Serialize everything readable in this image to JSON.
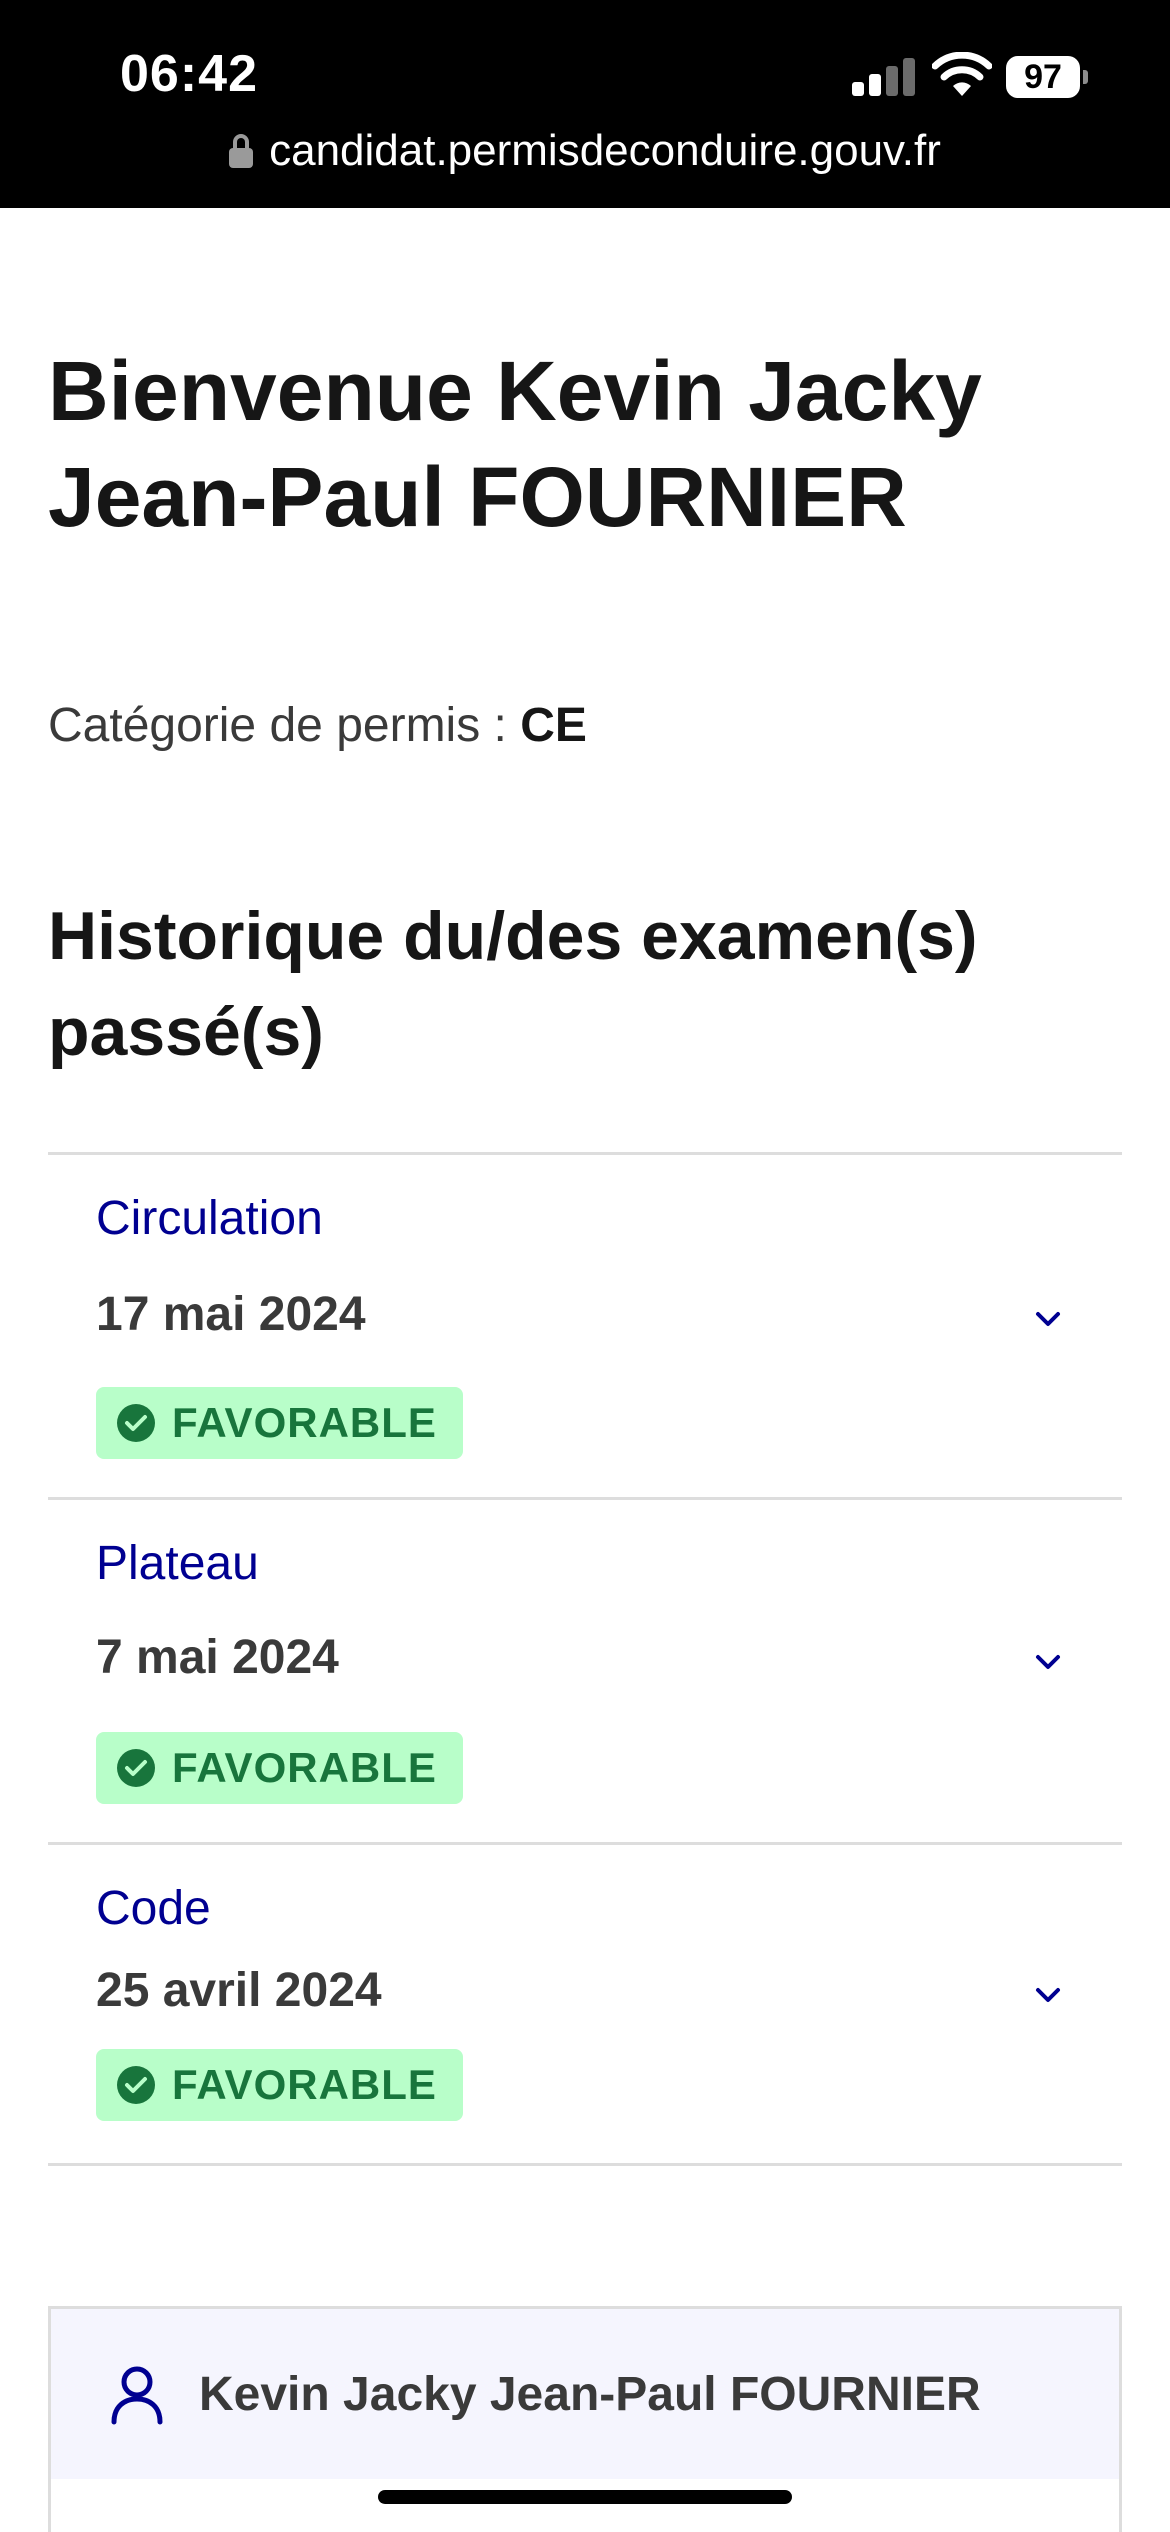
{
  "status_bar": {
    "time": "06:42",
    "battery": "97"
  },
  "browser": {
    "url": "candidat.permisdeconduire.gouv.fr"
  },
  "page": {
    "welcome": "Bienvenue Kevin Jacky Jean-Paul FOURNIER",
    "category_label": "Catégorie de permis : ",
    "category_value": "CE",
    "history_title": "Historique du/des examen(s) passé(s)"
  },
  "exams": [
    {
      "type": "Circulation",
      "date": "17 mai 2024",
      "result": "FAVORABLE"
    },
    {
      "type": "Plateau",
      "date": "7 mai 2024",
      "result": "FAVORABLE"
    },
    {
      "type": "Code",
      "date": "25 avril 2024",
      "result": "FAVORABLE"
    }
  ],
  "profile": {
    "name": "Kevin Jacky Jean-Paul FOURNIER"
  },
  "colors": {
    "accent_blue": "#000091",
    "success_bg": "#b8fec9",
    "success_text": "#18753c"
  }
}
